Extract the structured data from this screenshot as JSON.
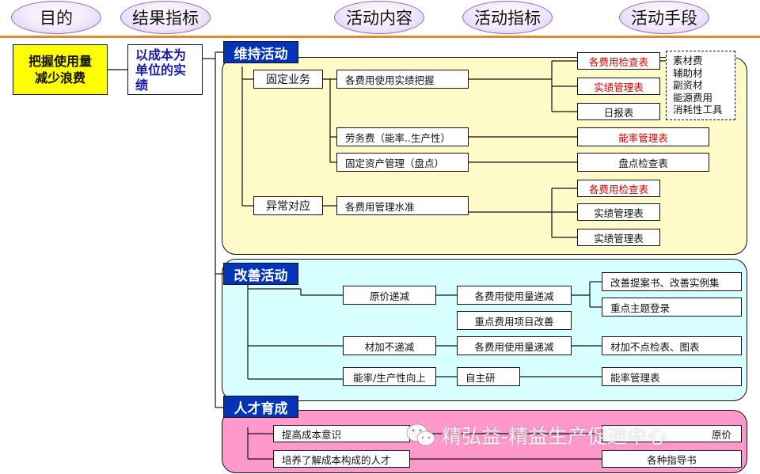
{
  "header": {
    "col1": "目的",
    "col2": "结果指标",
    "col3": "活动内容",
    "col4": "活动指标",
    "col5": "活动手段"
  },
  "purpose": {
    "line1": "把握使用量",
    "line2": "减少浪费"
  },
  "result": {
    "line1": "以成本为",
    "line2": "单位的实",
    "line3": "绩"
  },
  "maintain": {
    "title": "维持活动",
    "fixed": "固定业务",
    "abnormal": "异常对应",
    "act1": "各费用使用实绩把握",
    "act2": "劳务费（能率..生产性）",
    "act3": "固定资产管理（盘点）",
    "act4": "各费用管理水准",
    "m1": "各费用检查表",
    "m2": "实绩管理表",
    "m3": "日报表",
    "m4": "能率管理表",
    "m5": "盘点检查表",
    "m6": "各费用检查表",
    "m7": "实绩管理表",
    "m8": "实绩管理表",
    "notes": [
      "素材费",
      "辅助材",
      "副资材",
      "能源费用",
      "消耗性工具"
    ]
  },
  "improve": {
    "title": "改善活动",
    "c1": "原价递减",
    "c2": "材加不递减",
    "c3": "能率/生产性向上",
    "i1": "各费用使用量递减",
    "i2": "重点费用项目改善",
    "i3": "各费用使用量递减",
    "i4": "自主研",
    "m1": "改善提案书、改善实例集",
    "m2": "重点主题登录",
    "m3": "材加不点检表、图表",
    "m4": "能率管理表"
  },
  "talent": {
    "title": "人才育成",
    "a1": "提高成本意识",
    "a2": "培养了解成本构成的人才",
    "m1": "原价",
    "m2": "各种指导书"
  },
  "watermark": "精弘益-精益生产促进中心",
  "colors": {
    "section_blue": "#0033b8",
    "purpose_yellow": "#ffff00",
    "maintain_panel": "#fffbc8",
    "improve_panel": "#d8ffff",
    "talent_panel": "#ff99cc",
    "header_line": "#e0892a",
    "red_text": "#d80000",
    "result_text": "#1a1aa8"
  },
  "icons": [
    "wechat-icon"
  ]
}
